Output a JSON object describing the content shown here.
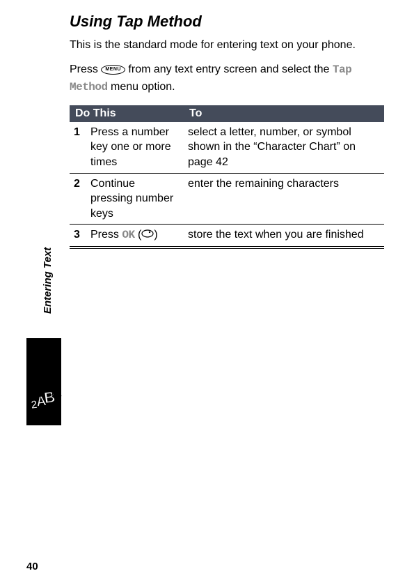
{
  "heading": "Using Tap Method",
  "intro": "This is the standard mode for entering text on your phone.",
  "instruction_pre": "Press ",
  "menu_key_label": "MENU",
  "instruction_mid": " from any text entry screen and select the ",
  "tap_method_label": "Tap Method",
  "instruction_post": " menu option.",
  "table": {
    "headers": {
      "do": "Do This",
      "to": "To"
    },
    "rows": [
      {
        "num": "1",
        "do": "Press a number key one or more times",
        "to": "select a letter, number, or symbol shown in the “Character Chart” on page 42"
      },
      {
        "num": "2",
        "do": "Continue pressing number keys",
        "to": "enter the remaining characters"
      },
      {
        "num": "3",
        "do_pre": "Press ",
        "ok": "OK",
        "do_post": " (",
        "do_end": ")",
        "to": "store the text when you are finished"
      }
    ]
  },
  "sidebar_label": "Entering Text",
  "page_number": "40"
}
